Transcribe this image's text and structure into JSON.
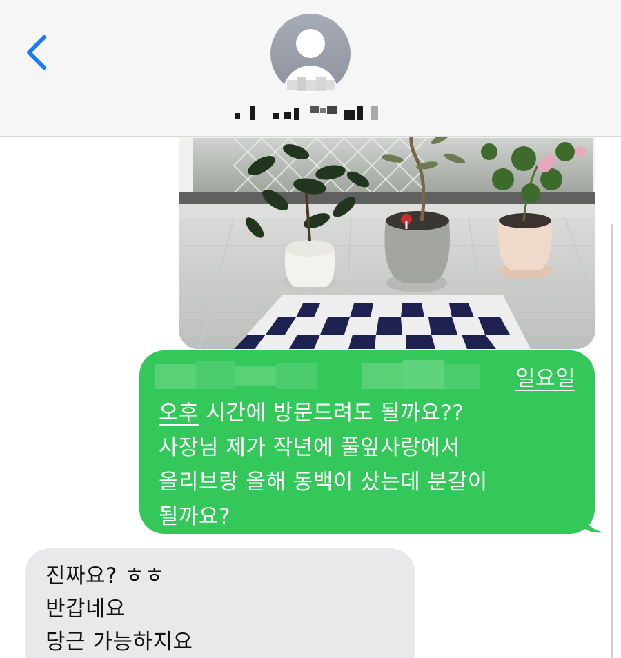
{
  "header": {
    "back_icon": "chevron-left-icon",
    "avatar_icon": "person-silhouette-icon",
    "contact_name_redacted": true,
    "accent_color": "#1a7cf0"
  },
  "thread": {
    "photo_attachment": {
      "kind": "image",
      "subject": "potted plants on a window sill"
    },
    "outgoing": {
      "bubble_color": "#34c759",
      "line1_link": "일요일",
      "line2_link": "오후",
      "line2_rest": " 시간에 방문드려도 될까요??",
      "line3": "사장님 제가 작년에 풀잎사랑에서",
      "line4": "올리브랑 올해 동백이 샀는데 분갈이",
      "line5": "될까요?"
    },
    "incoming": {
      "bubble_color": "#e9e9eb",
      "line1": "진짜요? ㅎㅎ",
      "line2": "반갑네요",
      "line3": "당근 가능하지요"
    }
  }
}
